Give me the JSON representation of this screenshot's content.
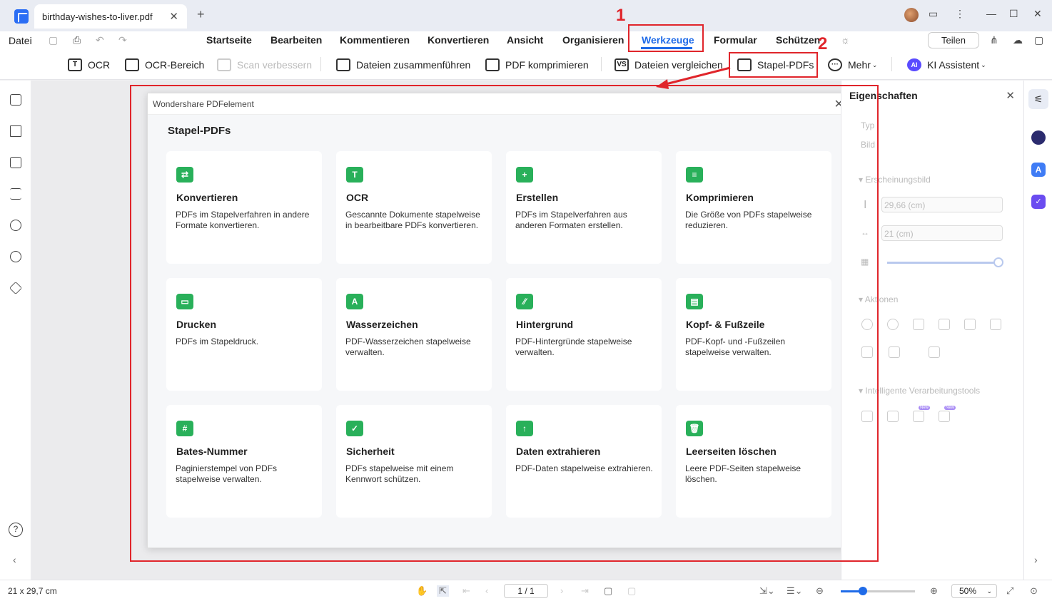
{
  "window": {
    "tab_title": "birthday-wishes-to-liver.pdf",
    "tab_close": "✕",
    "new_tab": "+"
  },
  "menu": {
    "file": "Datei",
    "items": [
      "Startseite",
      "Bearbeiten",
      "Kommentieren",
      "Konvertieren",
      "Ansicht",
      "Organisieren",
      "Werkzeuge",
      "Formular",
      "Schützen"
    ],
    "active": "Werkzeuge",
    "share": "Teilen"
  },
  "toolbar": {
    "ocr": "OCR",
    "ocr_area": "OCR-Bereich",
    "scan_improve": "Scan verbessern",
    "merge": "Dateien zusammenführen",
    "compress": "PDF komprimieren",
    "compare": "Dateien vergleichen",
    "batch": "Stapel-PDFs",
    "more": "Mehr",
    "ai": "KI Assistent",
    "ai_badge": "AI",
    "compare_badge": "VS",
    "ocr_badge": "T"
  },
  "dialog": {
    "window_title": "Wondershare PDFelement",
    "heading": "Stapel-PDFs",
    "close": "✕",
    "cards": [
      {
        "icon": "convert-icon",
        "glyph": "⇄",
        "title": "Konvertieren",
        "desc": "PDFs im Stapelverfahren in andere Formate konvertieren."
      },
      {
        "icon": "ocr-icon",
        "glyph": "T",
        "title": "OCR",
        "desc": "Gescannte Dokumente stapelweise in bearbeitbare PDFs konvertieren."
      },
      {
        "icon": "create-icon",
        "glyph": "+",
        "title": "Erstellen",
        "desc": "PDFs im Stapelverfahren aus anderen Formaten erstellen."
      },
      {
        "icon": "compress-icon",
        "glyph": "≡",
        "title": "Komprimieren",
        "desc": "Die Größe von PDFs stapelweise reduzieren."
      },
      {
        "icon": "print-icon",
        "glyph": "▭",
        "title": "Drucken",
        "desc": "PDFs im Stapeldruck."
      },
      {
        "icon": "watermark-icon",
        "glyph": "A",
        "title": "Wasserzeichen",
        "desc": "PDF-Wasserzeichen stapelweise verwalten."
      },
      {
        "icon": "background-icon",
        "glyph": "⁄⁄",
        "title": "Hintergrund",
        "desc": "PDF-Hintergründe stapelweise verwalten."
      },
      {
        "icon": "header-footer-icon",
        "glyph": "▤",
        "title": "Kopf- & Fußzeile",
        "desc": "PDF-Kopf- und -Fußzeilen stapelweise verwalten."
      },
      {
        "icon": "bates-number-icon",
        "glyph": "#",
        "title": "Bates-Nummer",
        "desc": "Paginierstempel von PDFs stapelweise verwalten."
      },
      {
        "icon": "security-shield-icon",
        "glyph": "✓",
        "title": "Sicherheit",
        "desc": "PDFs stapelweise mit einem Kennwort schützen."
      },
      {
        "icon": "extract-data-icon",
        "glyph": "↑",
        "title": "Daten extrahieren",
        "desc": "PDF-Daten stapelweise extrahieren."
      },
      {
        "icon": "delete-blank-pages-icon",
        "glyph": "🗑",
        "title": "Leerseiten löschen",
        "desc": "Leere PDF-Seiten stapelweise löschen."
      }
    ]
  },
  "properties": {
    "title": "Eigenschaften",
    "type_label": "Typ",
    "image_label": "Bild",
    "appearance": "Erscheinungsbild",
    "height": "29,66 (cm)",
    "width": "21 (cm)",
    "opacity_fraction": 1.0,
    "actions": "Aktionen",
    "smart_tools": "Intelligente Verarbeitungstools",
    "new_badge": "New"
  },
  "status": {
    "page_size": "21 x 29,7 cm",
    "page": "1 / 1",
    "zoom": "50%"
  },
  "annotations": {
    "step1": "1",
    "step2": "2",
    "color": "#e0252b"
  },
  "colors": {
    "accent": "#1f6be8",
    "card_icon": "#29b05a"
  }
}
